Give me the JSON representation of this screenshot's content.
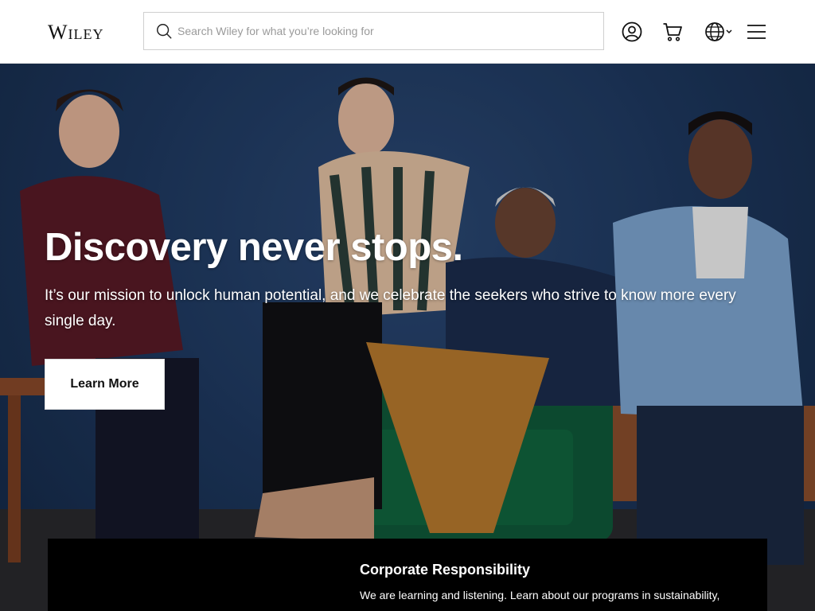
{
  "brand": {
    "logo_text": "Wiley"
  },
  "search": {
    "placeholder": "Search Wiley for what you’re looking for",
    "value": ""
  },
  "header_icons": [
    "user-account-icon",
    "shopping-cart-icon",
    "globe-icon",
    "hamburger-menu-icon"
  ],
  "hero": {
    "title": "Discovery never stops.",
    "subtitle": "It’s our mission to unlock human potential, and we celebrate the seekers who strive to know more every single day.",
    "cta_label": "Learn More"
  },
  "card": {
    "title": "Corporate Responsibility",
    "text": "We are learning and listening. Learn about our programs in sustainability,"
  },
  "colors": {
    "header_bg": "#ffffff",
    "hero_bg": "#1f3a62",
    "button_bg": "#ffffff",
    "card_bg": "#000000",
    "text_on_dark": "#ffffff"
  }
}
